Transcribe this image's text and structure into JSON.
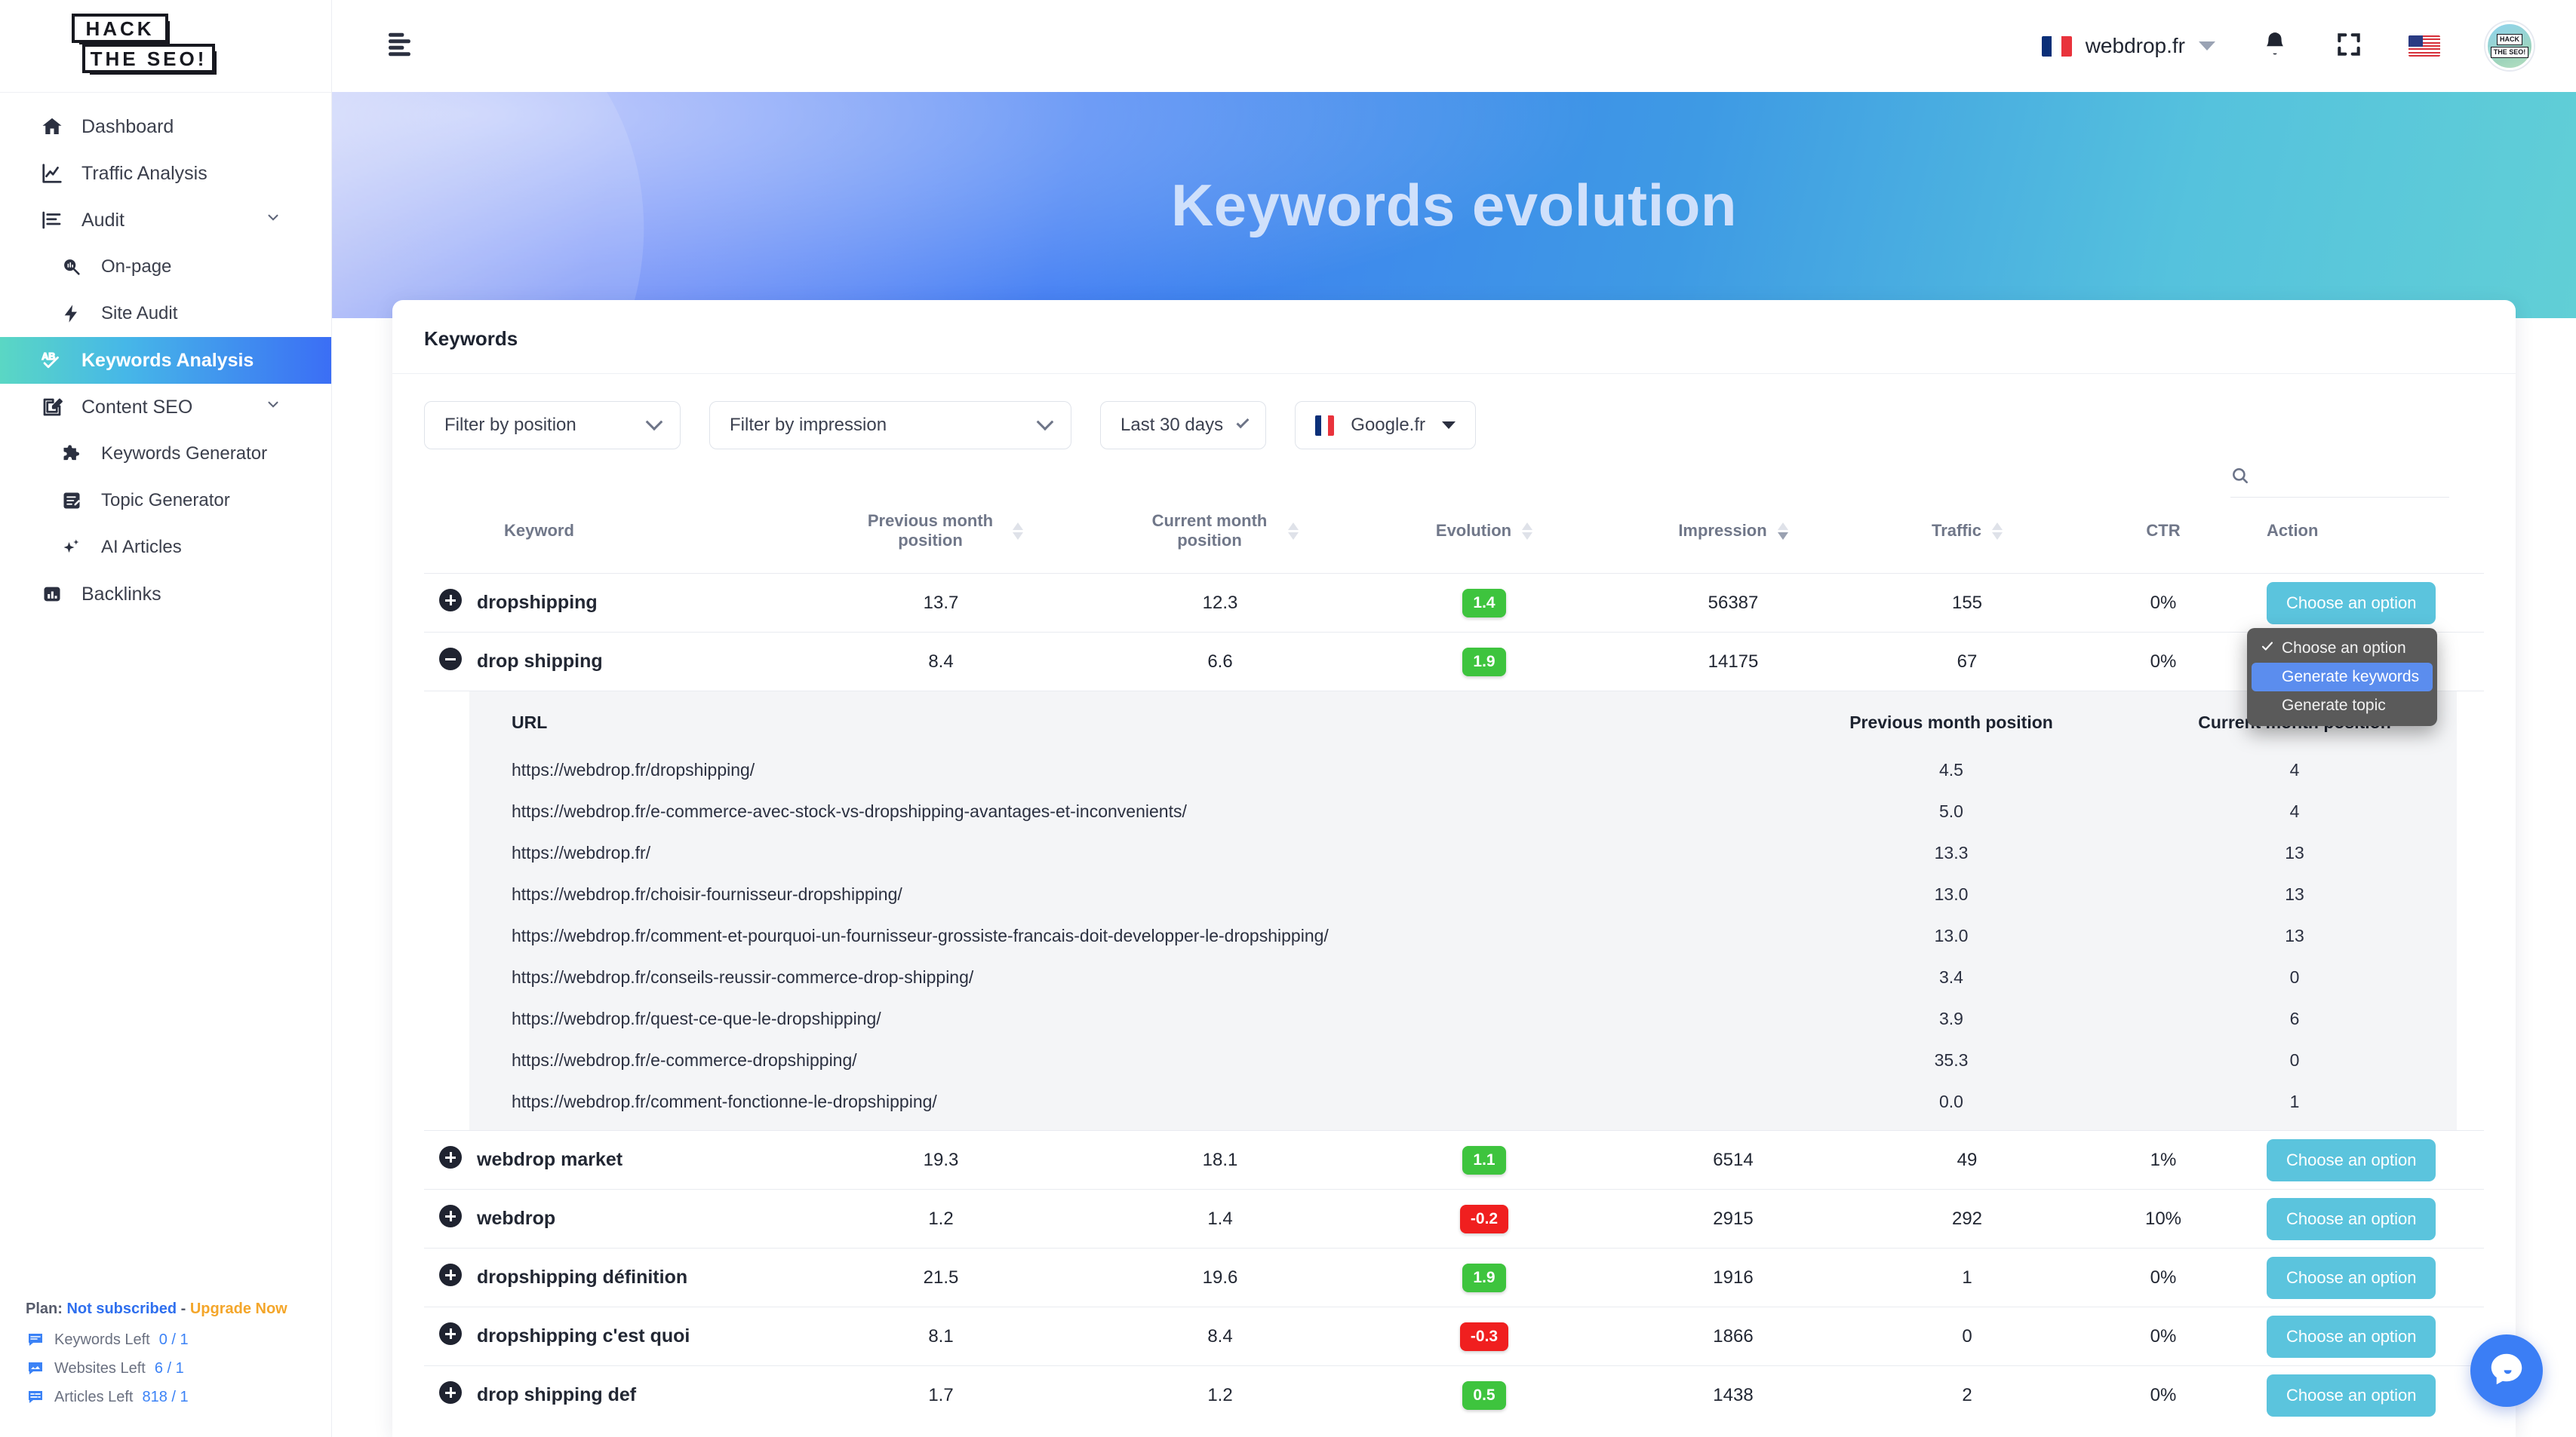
{
  "brand": {
    "line1": "HACK",
    "line2": "THE SEO!"
  },
  "sidebar": {
    "items": [
      {
        "label": "Dashboard",
        "icon": "home-icon"
      },
      {
        "label": "Traffic Analysis",
        "icon": "chart-line-icon"
      },
      {
        "label": "Audit",
        "icon": "list-bars-icon",
        "chevron": true
      },
      {
        "label": "On-page",
        "icon": "magnifier-chart-icon",
        "sub": true
      },
      {
        "label": "Site Audit",
        "icon": "bolt-icon",
        "sub": true
      },
      {
        "label": "Keywords Analysis",
        "icon": "ab-check-icon",
        "active": true
      },
      {
        "label": "Content SEO",
        "icon": "pencil-square-icon",
        "chevron": true
      },
      {
        "label": "Keywords Generator",
        "icon": "puzzle-icon",
        "sub": true
      },
      {
        "label": "Topic Generator",
        "icon": "note-edit-icon",
        "sub": true
      },
      {
        "label": "AI Articles",
        "icon": "sparkles-icon",
        "sub": true
      },
      {
        "label": "Backlinks",
        "icon": "bar-chart-icon"
      }
    ]
  },
  "plan": {
    "prefix": "Plan:",
    "status": "Not subscribed",
    "dash": "-",
    "upgrade": "Upgrade Now",
    "quotas": [
      {
        "label": "Keywords Left",
        "value": "0 / 1",
        "icon": "message-icon"
      },
      {
        "label": "Websites Left",
        "value": "6 / 1",
        "icon": "image-message-icon"
      },
      {
        "label": "Articles Left",
        "value": "818 / 1",
        "icon": "text-message-icon"
      }
    ]
  },
  "topbar": {
    "menu_icon": "hamburger-icon",
    "site": "webdrop.fr",
    "site_flag": "flag-fr",
    "bell_icon": "bell-icon",
    "fullscreen_icon": "fullscreen-icon",
    "lang_flag": "flag-us",
    "avatar": "user-avatar"
  },
  "hero": {
    "title": "Keywords evolution"
  },
  "card": {
    "title": "Keywords",
    "filters": {
      "position": "Filter by position",
      "impression": "Filter by impression",
      "range": "Last 30 days",
      "engine": "Google.fr"
    },
    "search_placeholder": ""
  },
  "table": {
    "headers": {
      "keyword": "Keyword",
      "prev": "Previous month position",
      "curr": "Current month position",
      "evolution": "Evolution",
      "impression": "Impression",
      "traffic": "Traffic",
      "ctr": "CTR",
      "action": "Action"
    },
    "action_label": "Choose an option",
    "rows": [
      {
        "keyword": "dropshipping",
        "prev": "13.7",
        "curr": "12.3",
        "evolution": "1.4",
        "evo_dir": "pos",
        "impression": "56387",
        "traffic": "155",
        "ctr": "0%",
        "expanded": false
      },
      {
        "keyword": "drop shipping",
        "prev": "8.4",
        "curr": "6.6",
        "evolution": "1.9",
        "evo_dir": "pos",
        "impression": "14175",
        "traffic": "67",
        "ctr": "0%",
        "expanded": true
      },
      {
        "keyword": "webdrop market",
        "prev": "19.3",
        "curr": "18.1",
        "evolution": "1.1",
        "evo_dir": "pos",
        "impression": "6514",
        "traffic": "49",
        "ctr": "1%",
        "expanded": false
      },
      {
        "keyword": "webdrop",
        "prev": "1.2",
        "curr": "1.4",
        "evolution": "-0.2",
        "evo_dir": "neg",
        "impression": "2915",
        "traffic": "292",
        "ctr": "10%",
        "expanded": false
      },
      {
        "keyword": "dropshipping définition",
        "prev": "21.5",
        "curr": "19.6",
        "evolution": "1.9",
        "evo_dir": "pos",
        "impression": "1916",
        "traffic": "1",
        "ctr": "0%",
        "expanded": false
      },
      {
        "keyword": "dropshipping c'est quoi",
        "prev": "8.1",
        "curr": "8.4",
        "evolution": "-0.3",
        "evo_dir": "neg",
        "impression": "1866",
        "traffic": "0",
        "ctr": "0%",
        "expanded": false
      },
      {
        "keyword": "drop shipping def",
        "prev": "1.7",
        "curr": "1.2",
        "evolution": "0.5",
        "evo_dir": "pos",
        "impression": "1438",
        "traffic": "2",
        "ctr": "0%",
        "expanded": false
      }
    ]
  },
  "subtable": {
    "headers": {
      "url": "URL",
      "prev": "Previous month position",
      "curr": "Current month position"
    },
    "rows": [
      {
        "url": "https://webdrop.fr/dropshipping/",
        "prev": "4.5",
        "curr": "4"
      },
      {
        "url": "https://webdrop.fr/e-commerce-avec-stock-vs-dropshipping-avantages-et-inconvenients/",
        "prev": "5.0",
        "curr": "4"
      },
      {
        "url": "https://webdrop.fr/",
        "prev": "13.3",
        "curr": "13"
      },
      {
        "url": "https://webdrop.fr/choisir-fournisseur-dropshipping/",
        "prev": "13.0",
        "curr": "13"
      },
      {
        "url": "https://webdrop.fr/comment-et-pourquoi-un-fournisseur-grossiste-francais-doit-developper-le-dropshipping/",
        "prev": "13.0",
        "curr": "13"
      },
      {
        "url": "https://webdrop.fr/conseils-reussir-commerce-drop-shipping/",
        "prev": "3.4",
        "curr": "0"
      },
      {
        "url": "https://webdrop.fr/quest-ce-que-le-dropshipping/",
        "prev": "3.9",
        "curr": "6"
      },
      {
        "url": "https://webdrop.fr/e-commerce-dropshipping/",
        "prev": "35.3",
        "curr": "0"
      },
      {
        "url": "https://webdrop.fr/comment-fonctionne-le-dropshipping/",
        "prev": "0.0",
        "curr": "1"
      }
    ]
  },
  "context_menu": {
    "items": [
      {
        "label": "Choose an option",
        "checked": true,
        "selected": false
      },
      {
        "label": "Generate keywords",
        "checked": false,
        "selected": true
      },
      {
        "label": "Generate topic",
        "checked": false,
        "selected": false
      }
    ]
  },
  "chat": {
    "icon": "chat-bubble-icon"
  },
  "colors": {
    "accent_blue": "#3b7ef5",
    "action_button": "#5bc4dd",
    "positive": "#3ec43e",
    "negative": "#f01f1f",
    "upgrade": "#f4a62a"
  }
}
